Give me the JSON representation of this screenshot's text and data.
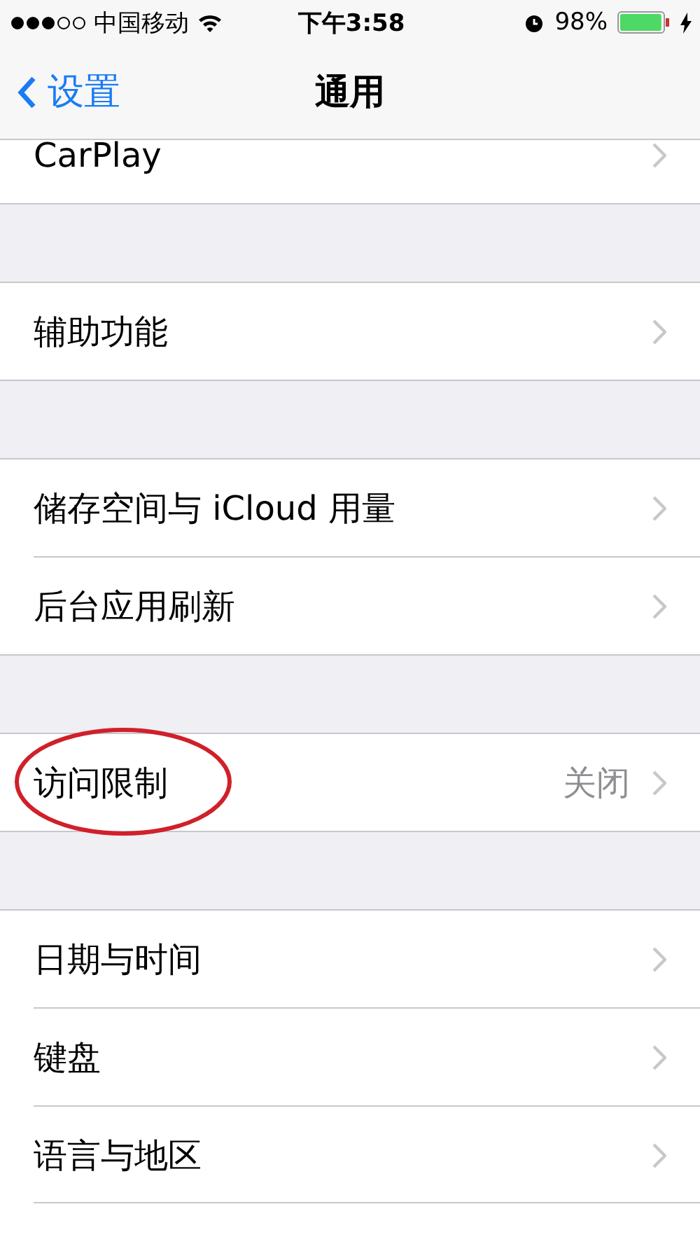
{
  "status_bar": {
    "carrier": "中国移动",
    "time": "下午3:58",
    "battery_text": "98%",
    "battery": {
      "level": 0.98
    }
  },
  "nav": {
    "back_label": "设置",
    "title": "通用"
  },
  "groups": [
    {
      "items": [
        {
          "label": "CarPlay"
        }
      ]
    },
    {
      "items": [
        {
          "label": "辅助功能"
        }
      ]
    },
    {
      "items": [
        {
          "label": "储存空间与 iCloud 用量"
        },
        {
          "label": "后台应用刷新"
        }
      ]
    },
    {
      "items": [
        {
          "label": "访问限制",
          "value": "关闭",
          "circled": true
        }
      ]
    },
    {
      "items": [
        {
          "label": "日期与时间"
        },
        {
          "label": "键盘"
        },
        {
          "label": "语言与地区"
        }
      ]
    }
  ]
}
